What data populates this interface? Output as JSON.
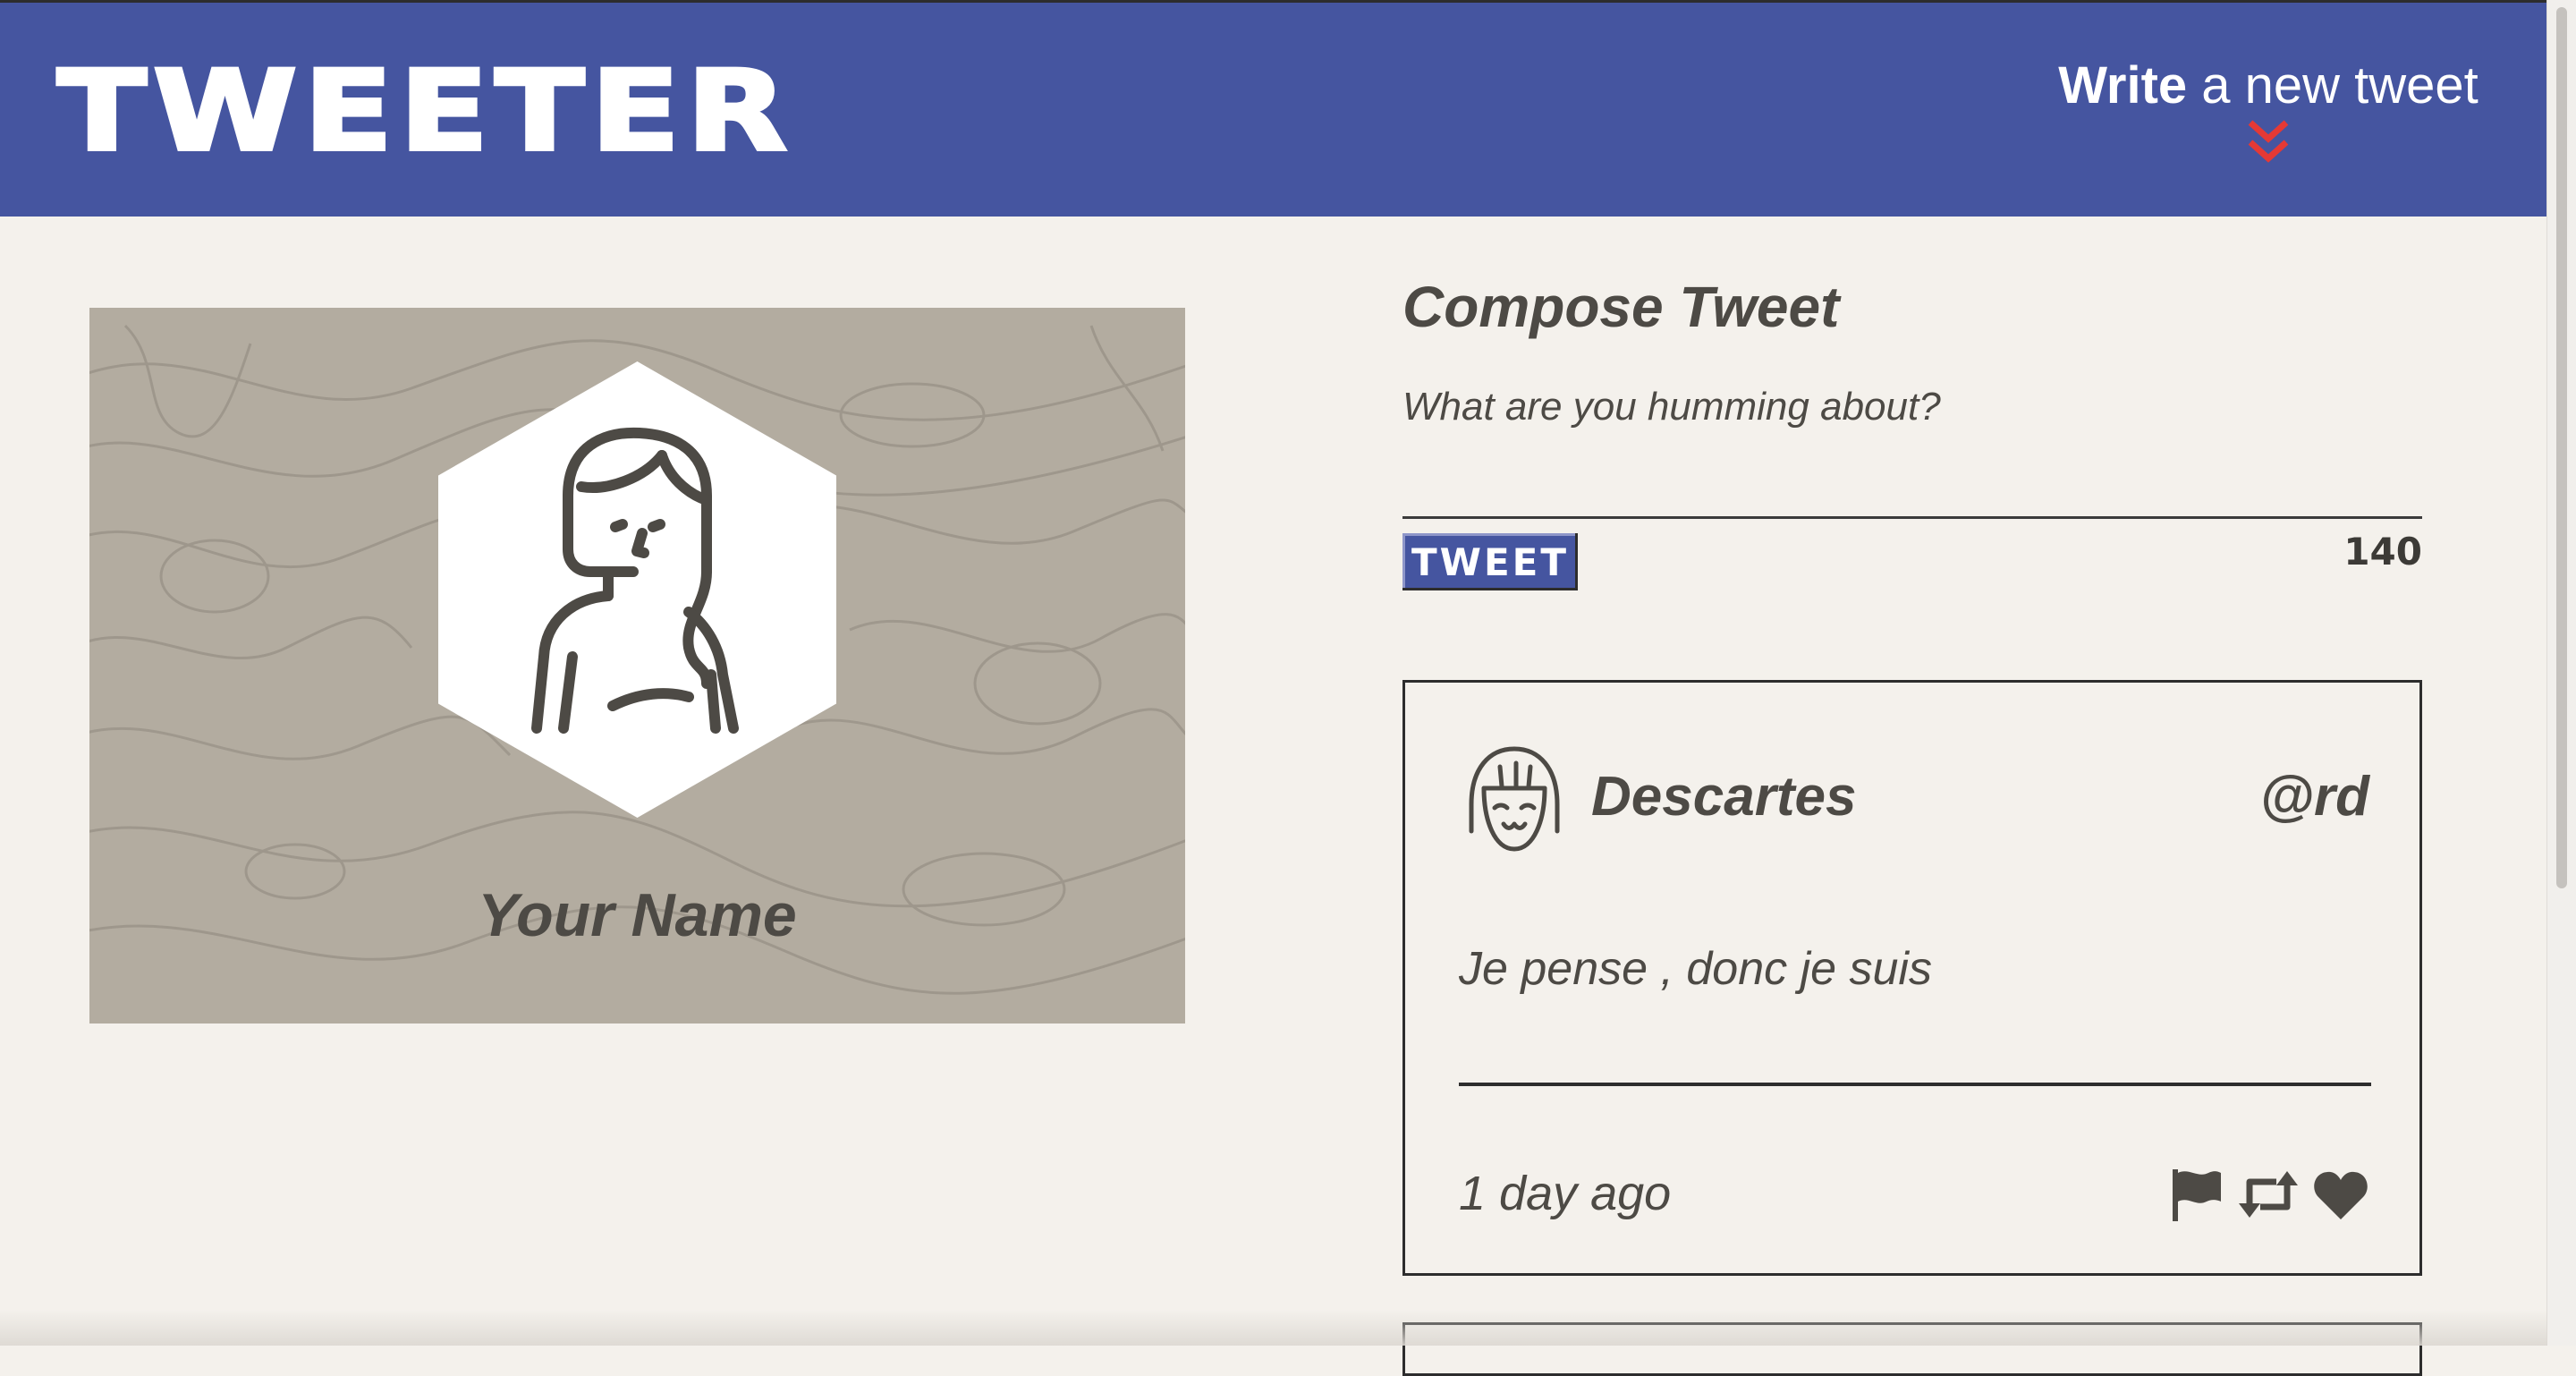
{
  "header": {
    "logo": "TWEETER",
    "write_bold": "Write",
    "write_rest": " a new tweet",
    "chevron_icon": "double-chevron-down-icon",
    "chevron_color": "#e53935",
    "bg_color": "#4555a0"
  },
  "profile": {
    "avatar_icon": "user-avatar-icon",
    "name": "Your Name"
  },
  "compose": {
    "title": "Compose Tweet",
    "placeholder": "What are you humming about?",
    "button_label": "TWEET",
    "counter": "140"
  },
  "tweets": [
    {
      "author": "Descartes",
      "handle": "@rd",
      "text": "Je pense , donc je suis",
      "time": "1 day ago",
      "avatar_icon": "avatar-icon",
      "actions": [
        "flag-icon",
        "retweet-icon",
        "heart-icon"
      ]
    }
  ]
}
